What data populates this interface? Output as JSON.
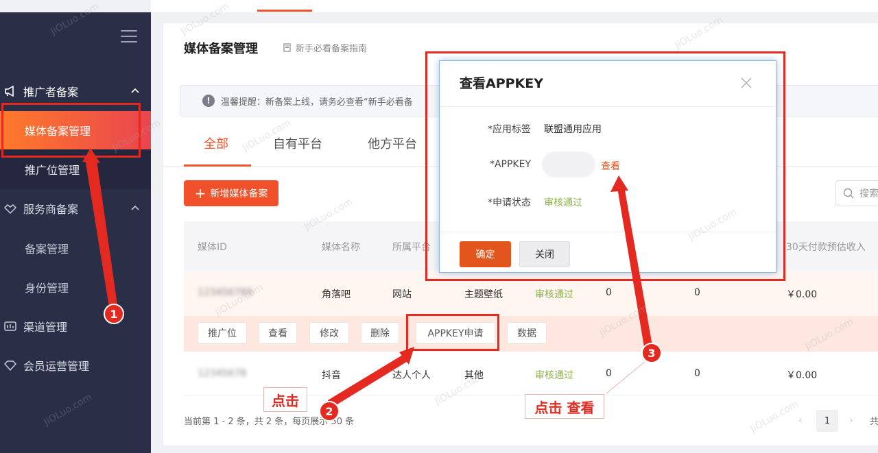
{
  "sidebar": {
    "groups": [
      {
        "label": "推广者备案",
        "icon": "megaphone-icon"
      },
      {
        "label": "服务商备案",
        "icon": "handshake-icon"
      },
      {
        "label": "渠道管理",
        "icon": "channel-icon"
      },
      {
        "label": "会员运营管理",
        "icon": "diamond-icon"
      }
    ],
    "items": [
      {
        "label": "媒体备案管理"
      },
      {
        "label": "推广位管理"
      },
      {
        "label": "备案管理"
      },
      {
        "label": "身份管理"
      }
    ]
  },
  "page": {
    "title": "媒体备案管理",
    "guide_link": "新手必看备案指南",
    "notice": "温馨提醒：新备案上线，请务必查看“新手必看备"
  },
  "tabs": [
    "全部",
    "自有平台",
    "他方平台"
  ],
  "toolbar": {
    "add_label": "新增媒体备案",
    "search_placeholder": "搜索"
  },
  "table": {
    "headers": [
      "媒体ID",
      "媒体名称",
      "所属平台",
      "30天付款预估收入"
    ],
    "rows": [
      {
        "id": "123456789",
        "name": "角落吧",
        "platform": "网站",
        "category": "主题壁纸",
        "status": "审核通过",
        "c1": "0",
        "c2": "0",
        "income": "￥0.00"
      },
      {
        "id": "12345678",
        "name": "抖音",
        "platform": "达人个人",
        "category": "其他",
        "status": "审核通过",
        "c1": "0",
        "c2": "0",
        "income": "￥0.00"
      }
    ],
    "row_actions": [
      "推广位",
      "查看",
      "修改",
      "删除",
      "APPKEY申请",
      "数据"
    ]
  },
  "pagination": {
    "summary": "当前第 1 - 2 条，共 2 条，每页展示 50 条",
    "current_page": "1",
    "total_prefix": "共"
  },
  "modal": {
    "title": "查看APPKEY",
    "fields": [
      {
        "label": "*应用标签",
        "value": "联盟通用应用"
      },
      {
        "label": "*APPKEY",
        "value": "查看"
      },
      {
        "label": "*申请状态",
        "value": "审核通过"
      }
    ],
    "ok_label": "确定",
    "close_label": "关闭"
  },
  "annotations": {
    "steps": [
      "1",
      "2",
      "3"
    ],
    "click_label": "点击",
    "click_view_label": "点击 查看"
  },
  "watermark": "JiOLuo.com",
  "colors": {
    "accent": "#f0502a",
    "sidebar": "#2b2e47",
    "success": "#8cb34a",
    "annotation": "#e42a20"
  }
}
